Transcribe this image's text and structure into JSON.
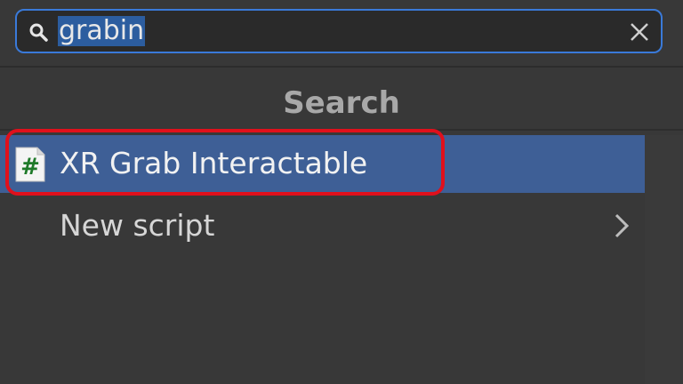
{
  "search": {
    "value": "grabin"
  },
  "results": {
    "header": "Search",
    "items": [
      {
        "label": "XR Grab Interactable",
        "icon": "script-icon"
      }
    ],
    "new_script_label": "New script"
  },
  "colors": {
    "accent": "#3a7ad9",
    "selection": "#3e5f96",
    "highlight_ring": "#e0101c",
    "background": "#383838"
  }
}
